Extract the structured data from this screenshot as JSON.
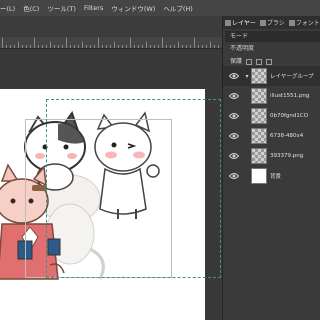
{
  "menu": [
    "ー(L)",
    "色(C)",
    "ツール(T)",
    "Filters",
    "ウィンドウ(W)",
    "ヘルプ(H)"
  ],
  "dock": {
    "tabs": [
      {
        "label": "レイヤー",
        "active": true
      },
      {
        "label": "ブラシ",
        "active": false
      },
      {
        "label": "フォント",
        "active": false
      }
    ],
    "mode_label": "モード",
    "opacity_label": "不透明度",
    "lock_label": "保護"
  },
  "layers": [
    {
      "name": "レイヤーグループ",
      "thumb": "checker",
      "expander": "▾",
      "selected": true
    },
    {
      "name": "illust1551.png",
      "thumb": "checker",
      "expander": "",
      "selected": false
    },
    {
      "name": "0b70fgnd1CO",
      "thumb": "checker",
      "expander": "",
      "selected": false
    },
    {
      "name": "6738-480x4",
      "thumb": "checker",
      "expander": "",
      "selected": false
    },
    {
      "name": "393379.png",
      "thumb": "checker",
      "expander": "",
      "selected": false
    },
    {
      "name": "背景",
      "thumb": "white",
      "expander": "",
      "selected": false
    }
  ]
}
